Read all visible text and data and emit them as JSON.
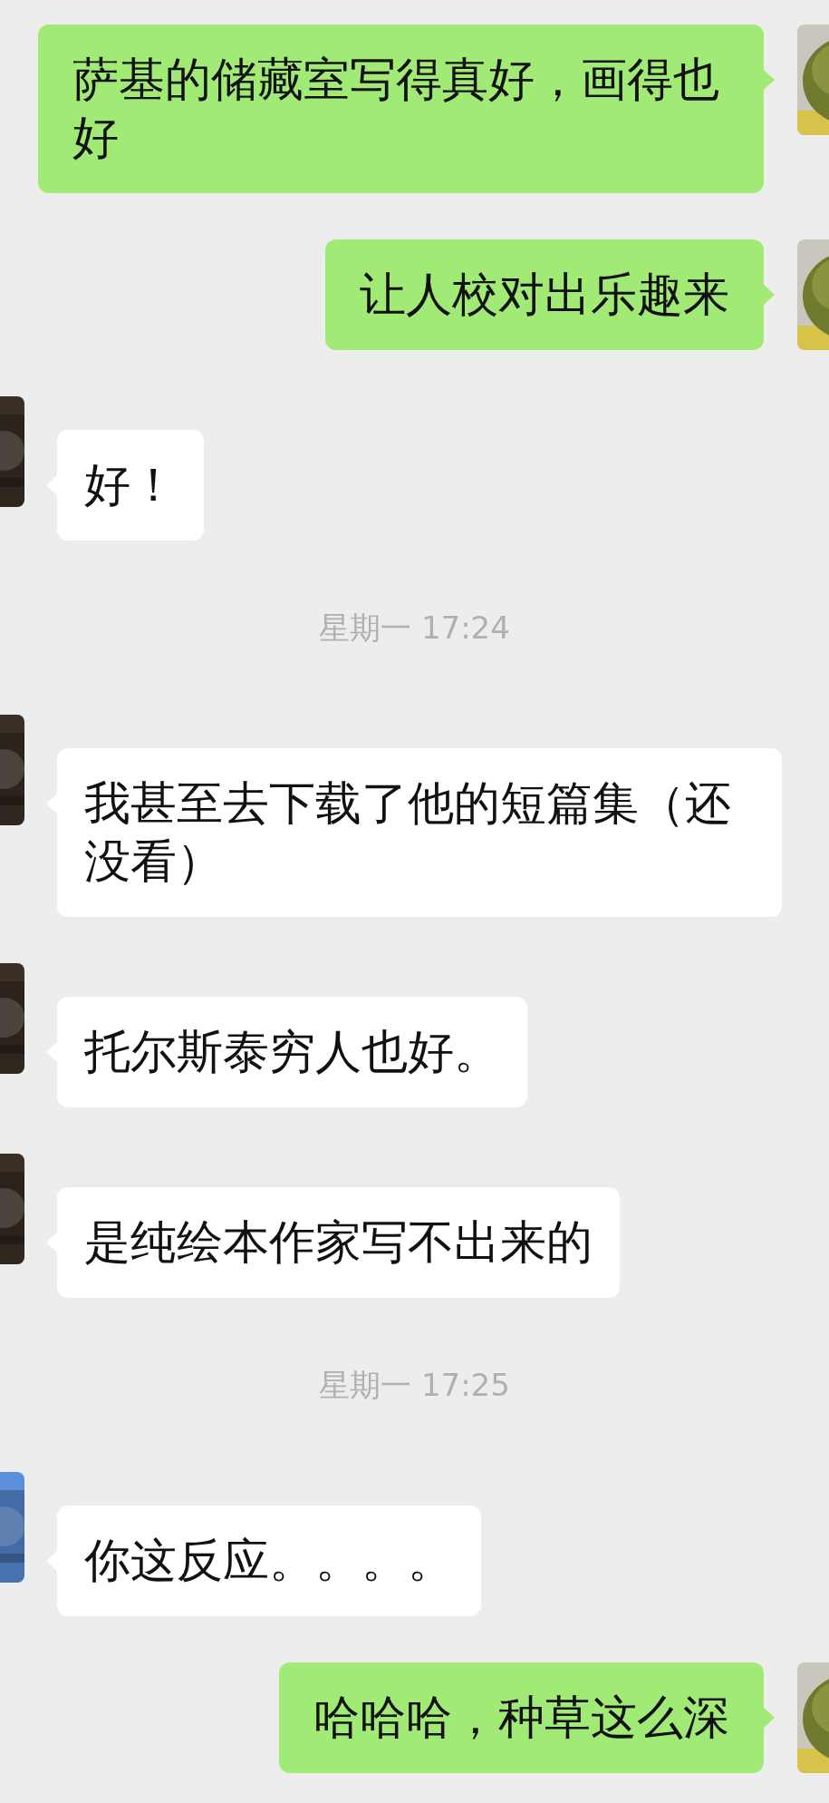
{
  "messages": [
    {
      "kind": "outgoing",
      "text": "萨基的储藏室写得真好，画得也好"
    },
    {
      "kind": "outgoing",
      "text": "让人校对出乐趣来"
    },
    {
      "kind": "incoming",
      "color": "#3b3026",
      "text": "好！"
    },
    {
      "kind": "time",
      "text": "星期一 17:24"
    },
    {
      "kind": "incoming",
      "color": "#3b3026",
      "text": "我甚至去下载了他的短篇集（还没看）"
    },
    {
      "kind": "incoming",
      "color": "#3b3026",
      "text": "托尔斯泰穷人也好。"
    },
    {
      "kind": "incoming",
      "color": "#3b3026",
      "text": "是纯绘本作家写不出来的"
    },
    {
      "kind": "time",
      "text": "星期一 17:25"
    },
    {
      "kind": "incoming",
      "color": "#5b8fdc",
      "text": "你这反应。。。。"
    },
    {
      "kind": "outgoing",
      "text": "哈哈哈，种草这么深"
    }
  ]
}
